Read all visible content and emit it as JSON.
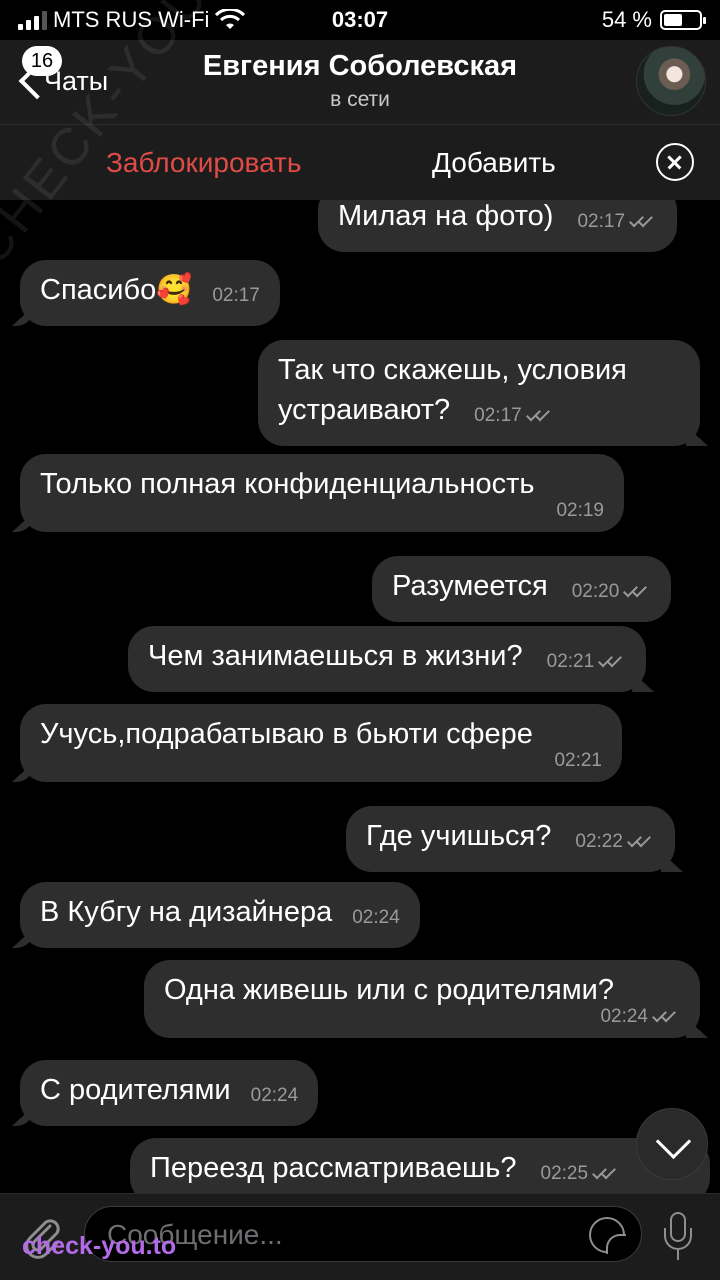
{
  "status_bar": {
    "carrier": "MTS RUS Wi-Fi",
    "time": "03:07",
    "battery": "54 %",
    "battery_level_percent": 54
  },
  "header": {
    "back_label": "Чаты",
    "unread_badge": "16",
    "contact_name": "Евгения Соболевская",
    "contact_status": "в сети"
  },
  "action_bar": {
    "block_label": "Заблокировать",
    "add_label": "Добавить"
  },
  "messages": [
    {
      "dir": "out",
      "text": "Милая на фото)",
      "time": "02:17",
      "read": true
    },
    {
      "dir": "in",
      "text": "Спасибо🥰",
      "time": "02:17"
    },
    {
      "dir": "out",
      "text": "Так что скажешь, условия устраивают?",
      "time": "02:17",
      "read": true
    },
    {
      "dir": "in",
      "text": "Только полная конфиденциальность",
      "time": "02:19"
    },
    {
      "dir": "out",
      "text": "Разумеется",
      "time": "02:20",
      "read": true
    },
    {
      "dir": "out",
      "text": "Чем занимаешься в жизни?",
      "time": "02:21",
      "read": true
    },
    {
      "dir": "in",
      "text": "Учусь,подрабатываю в бьюти сфере",
      "time": "02:21"
    },
    {
      "dir": "out",
      "text": "Где учишься?",
      "time": "02:22",
      "read": true
    },
    {
      "dir": "in",
      "text": "В Кубгу на дизайнера",
      "time": "02:24"
    },
    {
      "dir": "out",
      "text": "Одна живешь или с родителями?",
      "time": "02:24",
      "read": true
    },
    {
      "dir": "in",
      "text": "С родителями",
      "time": "02:24"
    },
    {
      "dir": "out",
      "text": "Переезд рассматриваешь?",
      "time": "02:25",
      "read": true
    }
  ],
  "input": {
    "placeholder": "Сообщение..."
  },
  "watermarks": {
    "diagonal": "CHECK-YOU.ME",
    "bottom": "check-you.to"
  },
  "colors": {
    "background": "#000000",
    "bar": "#1c1c1d",
    "bubble": "#2e2e2f",
    "danger": "#e04b46",
    "watermark_bottom": "#b36be8"
  },
  "icons": {
    "back": "chevron-left-icon",
    "close": "close-circle-icon",
    "attach": "paperclip-icon",
    "sticker": "sticker-icon",
    "mic": "microphone-icon",
    "scroll": "chevron-down-icon"
  }
}
